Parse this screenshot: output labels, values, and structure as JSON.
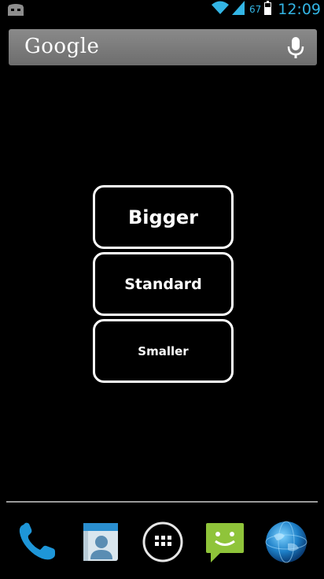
{
  "status_bar": {
    "battery_percent": "67",
    "time": "12:09",
    "colors": {
      "accent": "#33b5e5"
    },
    "icons": [
      "cyanogenmod-icon",
      "wifi-icon",
      "signal-icon",
      "battery-icon"
    ]
  },
  "search": {
    "logo_text": "Google",
    "icons": [
      "mic-icon"
    ]
  },
  "buttons": {
    "bigger": "Bigger",
    "standard": "Standard",
    "smaller": "Smaller"
  },
  "dock": {
    "icons": [
      "phone-icon",
      "contacts-icon",
      "app-drawer-icon",
      "messaging-icon",
      "browser-icon"
    ]
  }
}
